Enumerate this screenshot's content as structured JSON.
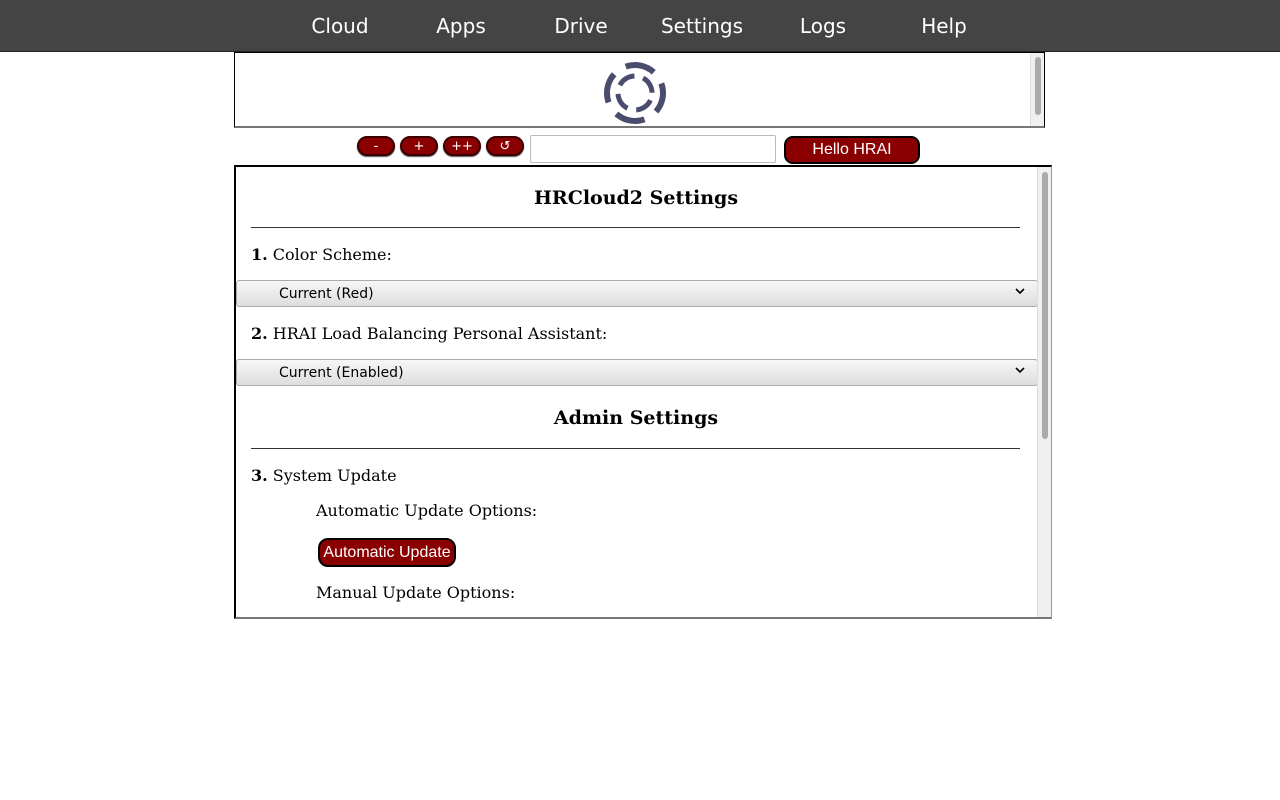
{
  "nav": {
    "items": [
      "Cloud",
      "Apps",
      "Drive",
      "Settings",
      "Logs",
      "Help"
    ]
  },
  "hrai": {
    "logo_icon": "hrai-logo-icon",
    "logo_color": "#4a4c6e",
    "controls": {
      "minus_label": "-",
      "plus_label": "+",
      "plusplus_label": "++",
      "refresh_label": "↺",
      "input_value": "",
      "hello_label": "Hello HRAI"
    }
  },
  "settings": {
    "title": "HRCloud2 Settings",
    "items": [
      {
        "number": "1.",
        "label": "Color Scheme:",
        "selected": "Current (Red)"
      },
      {
        "number": "2.",
        "label": "HRAI Load Balancing Personal Assistant:",
        "selected": "Current (Enabled)"
      }
    ],
    "admin_title": "Admin Settings",
    "system_update": {
      "number": "3.",
      "label": "System Update",
      "auto_label": "Automatic Update Options:",
      "auto_button": "Automatic Update",
      "manual_label": "Manual Update Options:"
    }
  },
  "colors": {
    "accent": "#8a0000",
    "nav_bg": "#444444"
  }
}
